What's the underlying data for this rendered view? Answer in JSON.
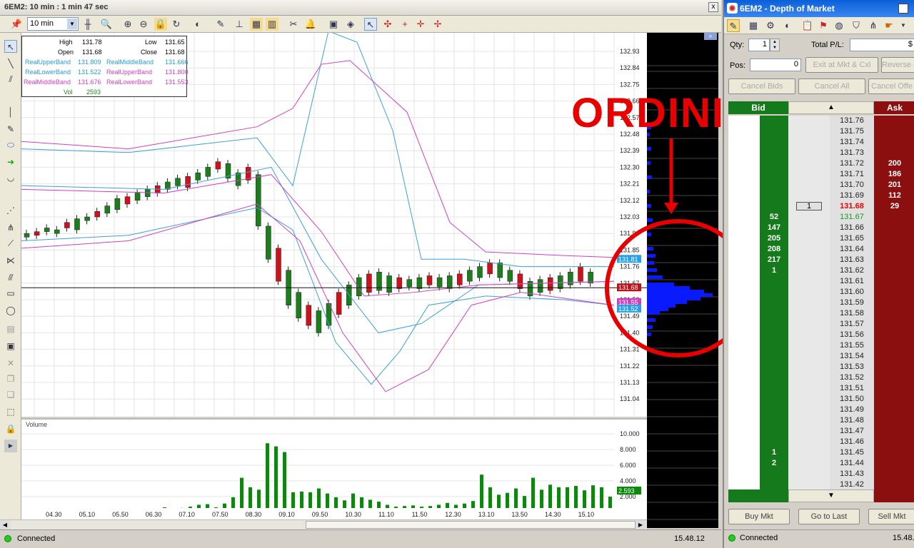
{
  "chart_window": {
    "title": "6EM2: 10 min : 1 min 47 sec",
    "close_glyph": "x",
    "interval": "10 min",
    "info": {
      "high_label": "High",
      "high": "131.78",
      "low_label": "Low",
      "low": "131.65",
      "open_label": "Open",
      "open": "131.68",
      "close_label": "Close",
      "close": "131.68",
      "r1a": "RealUpperBand",
      "r1b": "131.809",
      "r1c": "RealMiddleBand",
      "r1d": "131.666",
      "r2a": "RealLowerBand",
      "r2b": "131.522",
      "r2c": "RealUpperBand",
      "r2d": "131.800",
      "r3a": "RealMiddleBand",
      "r3b": "131.676",
      "r3c": "RealLowerBand",
      "r3d": "131.553",
      "vol_label": "Vol",
      "vol": "2593"
    },
    "price_axis": [
      "132.93",
      "132.84",
      "132.75",
      "132.66",
      "132.57",
      "132.48",
      "132.39",
      "132.30",
      "132.21",
      "132.12",
      "132.03",
      "131.94",
      "131.85",
      "131.76",
      "131.67",
      "131.58",
      "131.49",
      "131.40",
      "131.31",
      "131.22",
      "131.13",
      "131.04"
    ],
    "price_tags": {
      "upper": "131.81",
      "last": "131.68",
      "mid": "131.55",
      "lower": "131.52"
    },
    "volume_label": "Volume",
    "volume_axis": [
      "10.000",
      "8.000",
      "6.000",
      "4.000",
      "2.000"
    ],
    "volume_tag": "2.593",
    "time_axis": [
      "04.30",
      "05.10",
      "05.50",
      "06.30",
      "07.10",
      "07.50",
      "08.30",
      "09.10",
      "09.50",
      "10.30",
      "11.10",
      "11.50",
      "12.30",
      "13.10",
      "13.50",
      "14.30",
      "15.10"
    ],
    "status": "Connected",
    "clock": "15.48.12",
    "annotation": "ORDINI"
  },
  "dom_window": {
    "title": "6EM2 - Depth of Market",
    "qty_label": "Qty:",
    "qty": "1",
    "pl_label": "Total P/L:",
    "pl": "$",
    "pos_label": "Pos:",
    "pos": "0",
    "exit_btn": "Exit at Mkt & Cxl",
    "reverse_btn": "Reverse &",
    "cancel_bids": "Cancel Bids",
    "cancel_all": "Cancel All",
    "cancel_offers": "Cancel Offe",
    "bid_header": "Bid",
    "ask_header": "Ask",
    "buy_mkt": "Buy Mkt",
    "go_last": "Go to Last",
    "sell_mkt": "Sell Mkt",
    "status": "Connected",
    "clock": "15.48.",
    "rows": [
      {
        "price": "131.76",
        "bid": "",
        "ask": "",
        "ord": ""
      },
      {
        "price": "131.75",
        "bid": "",
        "ask": "",
        "ord": ""
      },
      {
        "price": "131.74",
        "bid": "",
        "ask": "",
        "ord": ""
      },
      {
        "price": "131.73",
        "bid": "",
        "ask": "",
        "ord": ""
      },
      {
        "price": "131.72",
        "bid": "",
        "ask": "200",
        "ord": ""
      },
      {
        "price": "131.71",
        "bid": "",
        "ask": "186",
        "ord": ""
      },
      {
        "price": "131.70",
        "bid": "",
        "ask": "201",
        "ord": ""
      },
      {
        "price": "131.69",
        "bid": "",
        "ask": "112",
        "ord": ""
      },
      {
        "price": "131.68",
        "bid": "",
        "ask": "29",
        "ord": "1",
        "last": true
      },
      {
        "price": "131.67",
        "bid": "52",
        "ask": "",
        "ord": "",
        "green": true
      },
      {
        "price": "131.66",
        "bid": "147",
        "ask": "",
        "ord": ""
      },
      {
        "price": "131.65",
        "bid": "205",
        "ask": "",
        "ord": ""
      },
      {
        "price": "131.64",
        "bid": "208",
        "ask": "",
        "ord": ""
      },
      {
        "price": "131.63",
        "bid": "217",
        "ask": "",
        "ord": ""
      },
      {
        "price": "131.62",
        "bid": "1",
        "ask": "",
        "ord": ""
      },
      {
        "price": "131.61",
        "bid": "",
        "ask": "",
        "ord": ""
      },
      {
        "price": "131.60",
        "bid": "",
        "ask": "",
        "ord": ""
      },
      {
        "price": "131.59",
        "bid": "",
        "ask": "",
        "ord": ""
      },
      {
        "price": "131.58",
        "bid": "",
        "ask": "",
        "ord": ""
      },
      {
        "price": "131.57",
        "bid": "",
        "ask": "",
        "ord": ""
      },
      {
        "price": "131.56",
        "bid": "",
        "ask": "",
        "ord": ""
      },
      {
        "price": "131.55",
        "bid": "",
        "ask": "",
        "ord": ""
      },
      {
        "price": "131.54",
        "bid": "",
        "ask": "",
        "ord": ""
      },
      {
        "price": "131.53",
        "bid": "",
        "ask": "",
        "ord": ""
      },
      {
        "price": "131.52",
        "bid": "",
        "ask": "",
        "ord": ""
      },
      {
        "price": "131.51",
        "bid": "",
        "ask": "",
        "ord": ""
      },
      {
        "price": "131.50",
        "bid": "",
        "ask": "",
        "ord": ""
      },
      {
        "price": "131.49",
        "bid": "",
        "ask": "",
        "ord": ""
      },
      {
        "price": "131.48",
        "bid": "",
        "ask": "",
        "ord": ""
      },
      {
        "price": "131.47",
        "bid": "",
        "ask": "",
        "ord": ""
      },
      {
        "price": "131.46",
        "bid": "",
        "ask": "",
        "ord": ""
      },
      {
        "price": "131.45",
        "bid": "1",
        "ask": "",
        "ord": ""
      },
      {
        "price": "131.44",
        "bid": "2",
        "ask": "",
        "ord": ""
      },
      {
        "price": "131.43",
        "bid": "",
        "ask": "",
        "ord": ""
      },
      {
        "price": "131.42",
        "bid": "",
        "ask": "",
        "ord": ""
      }
    ]
  },
  "colors": {
    "bull": "#1a7f1a",
    "bear": "#d0101a",
    "band_blue": "#3fa0d8",
    "band_pink": "#d040c0",
    "annotation": "#e80000",
    "profile": "#0a1aff"
  }
}
